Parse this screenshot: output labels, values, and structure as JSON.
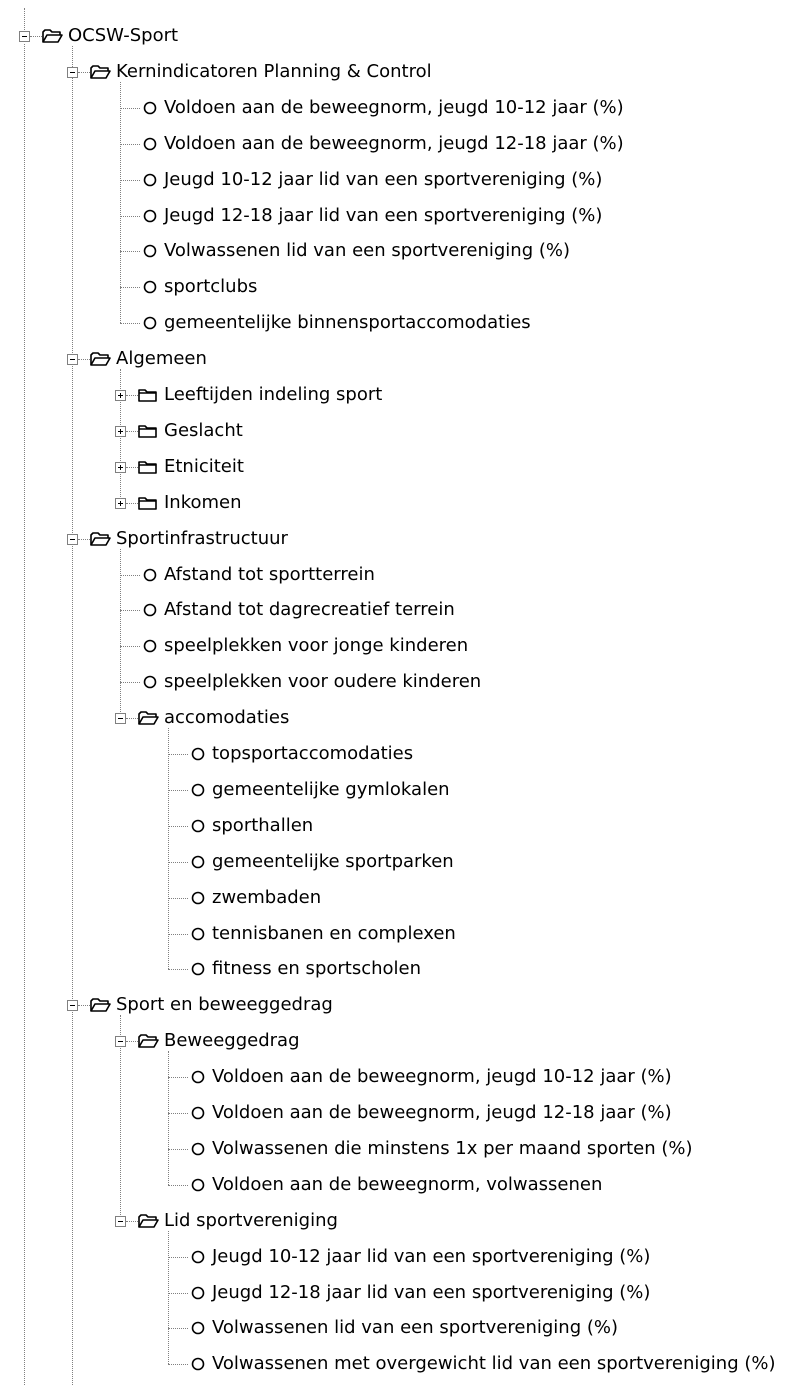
{
  "tree": {
    "root": {
      "label": "OCSW-Sport",
      "selected": true
    },
    "rows": [
      {
        "depth": 1,
        "kind": "folder-open",
        "label": "Kernindicatoren Planning & Control"
      },
      {
        "depth": 2,
        "kind": "leaf",
        "label": "Voldoen aan de beweegnorm, jeugd 10-12 jaar (%)"
      },
      {
        "depth": 2,
        "kind": "leaf",
        "label": "Voldoen aan de beweegnorm, jeugd 12-18 jaar (%)"
      },
      {
        "depth": 2,
        "kind": "leaf",
        "label": "Jeugd 10-12 jaar lid van een sportvereniging (%)"
      },
      {
        "depth": 2,
        "kind": "leaf",
        "label": "Jeugd 12-18 jaar lid van een sportvereniging (%)"
      },
      {
        "depth": 2,
        "kind": "leaf",
        "label": "Volwassenen lid van een sportvereniging (%)"
      },
      {
        "depth": 2,
        "kind": "leaf",
        "label": "sportclubs"
      },
      {
        "depth": 2,
        "kind": "leaf",
        "label": "gemeentelijke binnensportaccomodaties"
      },
      {
        "depth": 1,
        "kind": "folder-open",
        "label": "Algemeen"
      },
      {
        "depth": 2,
        "kind": "folder-closed",
        "label": "Leeftijden indeling sport"
      },
      {
        "depth": 2,
        "kind": "folder-closed",
        "label": "Geslacht"
      },
      {
        "depth": 2,
        "kind": "folder-closed",
        "label": "Etniciteit"
      },
      {
        "depth": 2,
        "kind": "folder-closed",
        "label": "Inkomen"
      },
      {
        "depth": 1,
        "kind": "folder-open",
        "label": "Sportinfrastructuur"
      },
      {
        "depth": 2,
        "kind": "leaf",
        "label": "Afstand tot sportterrein"
      },
      {
        "depth": 2,
        "kind": "leaf",
        "label": "Afstand tot dagrecreatief terrein"
      },
      {
        "depth": 2,
        "kind": "leaf",
        "label": "speelplekken voor jonge kinderen"
      },
      {
        "depth": 2,
        "kind": "leaf",
        "label": "speelplekken voor oudere kinderen"
      },
      {
        "depth": 2,
        "kind": "folder-open",
        "label": "accomodaties"
      },
      {
        "depth": 3,
        "kind": "leaf",
        "label": "topsportaccomodaties"
      },
      {
        "depth": 3,
        "kind": "leaf",
        "label": "gemeentelijke gymlokalen"
      },
      {
        "depth": 3,
        "kind": "leaf",
        "label": "sporthallen"
      },
      {
        "depth": 3,
        "kind": "leaf",
        "label": "gemeentelijke sportparken"
      },
      {
        "depth": 3,
        "kind": "leaf",
        "label": "zwembaden"
      },
      {
        "depth": 3,
        "kind": "leaf",
        "label": "tennisbanen en complexen"
      },
      {
        "depth": 3,
        "kind": "leaf",
        "label": "fitness en sportscholen"
      },
      {
        "depth": 1,
        "kind": "folder-open",
        "label": "Sport en beweeggedrag"
      },
      {
        "depth": 2,
        "kind": "folder-open",
        "label": "Beweeggedrag"
      },
      {
        "depth": 3,
        "kind": "leaf",
        "label": "Voldoen aan de beweegnorm, jeugd 10-12 jaar (%)"
      },
      {
        "depth": 3,
        "kind": "leaf",
        "label": "Voldoen aan de beweegnorm, jeugd 12-18 jaar (%)"
      },
      {
        "depth": 3,
        "kind": "leaf",
        "label": "Volwassenen die minstens 1x per maand sporten (%)"
      },
      {
        "depth": 3,
        "kind": "leaf",
        "label": "Voldoen aan de beweegnorm, volwassenen"
      },
      {
        "depth": 2,
        "kind": "folder-open",
        "label": "Lid sportvereniging"
      },
      {
        "depth": 3,
        "kind": "leaf",
        "label": "Jeugd 10-12 jaar lid van een sportvereniging (%)"
      },
      {
        "depth": 3,
        "kind": "leaf",
        "label": "Jeugd 12-18 jaar lid van een sportvereniging (%)"
      },
      {
        "depth": 3,
        "kind": "leaf",
        "label": "Volwassenen lid van een sportvereniging (%)"
      },
      {
        "depth": 3,
        "kind": "leaf",
        "label": "Volwassenen met overgewicht lid van een sportvereniging (%)"
      }
    ]
  }
}
